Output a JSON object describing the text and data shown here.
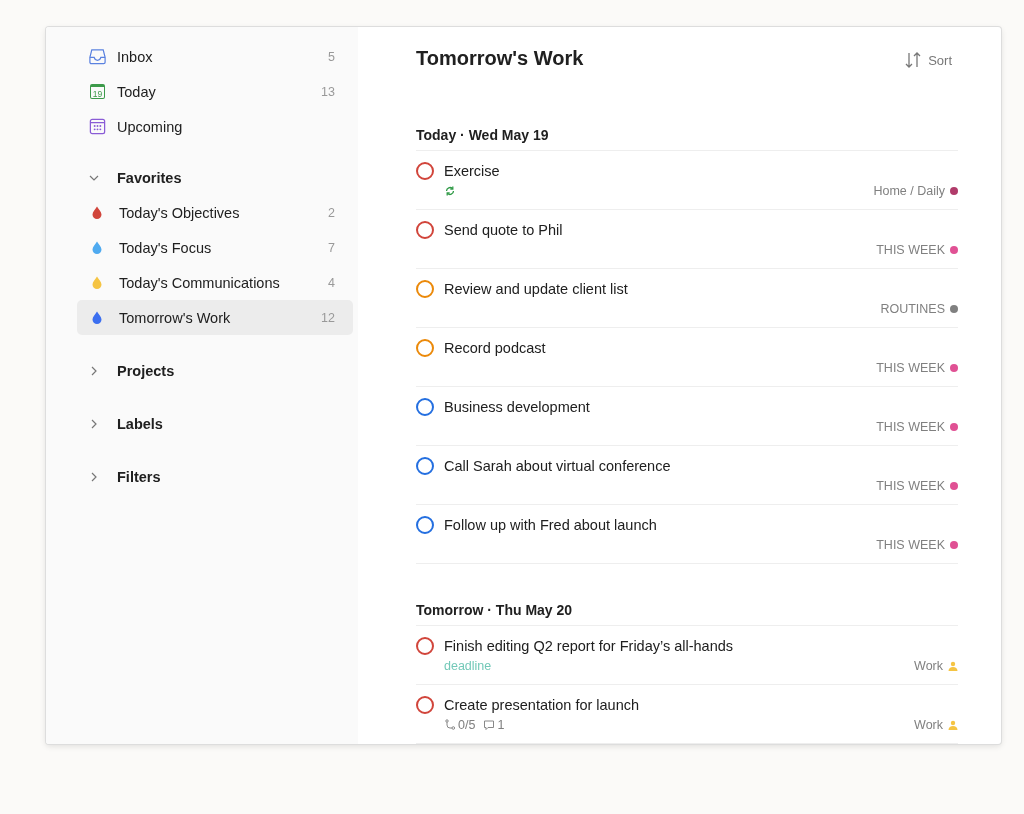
{
  "sidebar": {
    "nav": [
      {
        "kind": "inbox",
        "label": "Inbox",
        "count": "5"
      },
      {
        "kind": "today",
        "label": "Today",
        "count": "13",
        "icon_text": "19"
      },
      {
        "kind": "upcoming",
        "label": "Upcoming"
      }
    ],
    "sections": [
      {
        "title": "Favorites",
        "expanded": true,
        "items": [
          {
            "label": "Today's Objectives",
            "count": "2",
            "color": "#d1453b",
            "selected": false
          },
          {
            "label": "Today's Focus",
            "count": "7",
            "color": "#4faaf0",
            "selected": false
          },
          {
            "label": "Today's Communications",
            "count": "4",
            "color": "#f5c443",
            "selected": false
          },
          {
            "label": "Tomorrow's Work",
            "count": "12",
            "color": "#3c6ff0",
            "selected": true
          }
        ]
      },
      {
        "title": "Projects",
        "expanded": false
      },
      {
        "title": "Labels",
        "expanded": false
      },
      {
        "title": "Filters",
        "expanded": false
      }
    ]
  },
  "main": {
    "title": "Tomorrow's Work",
    "sort_label": "Sort",
    "groups": [
      {
        "heading": "Today · Wed May 19",
        "tasks": [
          {
            "title": "Exercise",
            "color": "#d1453b",
            "meta": [
              {
                "kind": "recurring"
              }
            ],
            "project": {
              "name": "Home / Daily",
              "kind": "dot",
              "color": "#b03b6a"
            }
          },
          {
            "title": "Send quote to Phil",
            "color": "#d1453b",
            "project": {
              "name": "THIS WEEK",
              "kind": "dot",
              "color": "#e05194"
            }
          },
          {
            "title": "Review and update client list",
            "color": "#eb8909",
            "project": {
              "name": "ROUTINES",
              "kind": "dot",
              "color": "#808080"
            }
          },
          {
            "title": "Record podcast",
            "color": "#eb8909",
            "project": {
              "name": "THIS WEEK",
              "kind": "dot",
              "color": "#e05194"
            }
          },
          {
            "title": "Business development",
            "color": "#246fe0",
            "project": {
              "name": "THIS WEEK",
              "kind": "dot",
              "color": "#e05194"
            }
          },
          {
            "title": "Call Sarah about virtual conference",
            "color": "#246fe0",
            "project": {
              "name": "THIS WEEK",
              "kind": "dot",
              "color": "#e05194"
            }
          },
          {
            "title": "Follow up with Fred about launch",
            "color": "#246fe0",
            "project": {
              "name": "THIS WEEK",
              "kind": "dot",
              "color": "#e05194"
            }
          }
        ]
      },
      {
        "heading": "Tomorrow · Thu May 20",
        "tasks": [
          {
            "title": "Finish editing Q2 report for Friday’s all-hands",
            "color": "#d1453b",
            "meta": [
              {
                "kind": "label",
                "text": "deadline"
              }
            ],
            "project": {
              "name": "Work",
              "kind": "person",
              "color": "#f5c443"
            }
          },
          {
            "title": "Create presentation for launch",
            "color": "#d1453b",
            "meta": [
              {
                "kind": "subtasks",
                "text": "0/5"
              },
              {
                "kind": "comments",
                "text": "1"
              }
            ],
            "project": {
              "name": "Work",
              "kind": "person",
              "color": "#f5c443"
            }
          }
        ]
      }
    ]
  }
}
